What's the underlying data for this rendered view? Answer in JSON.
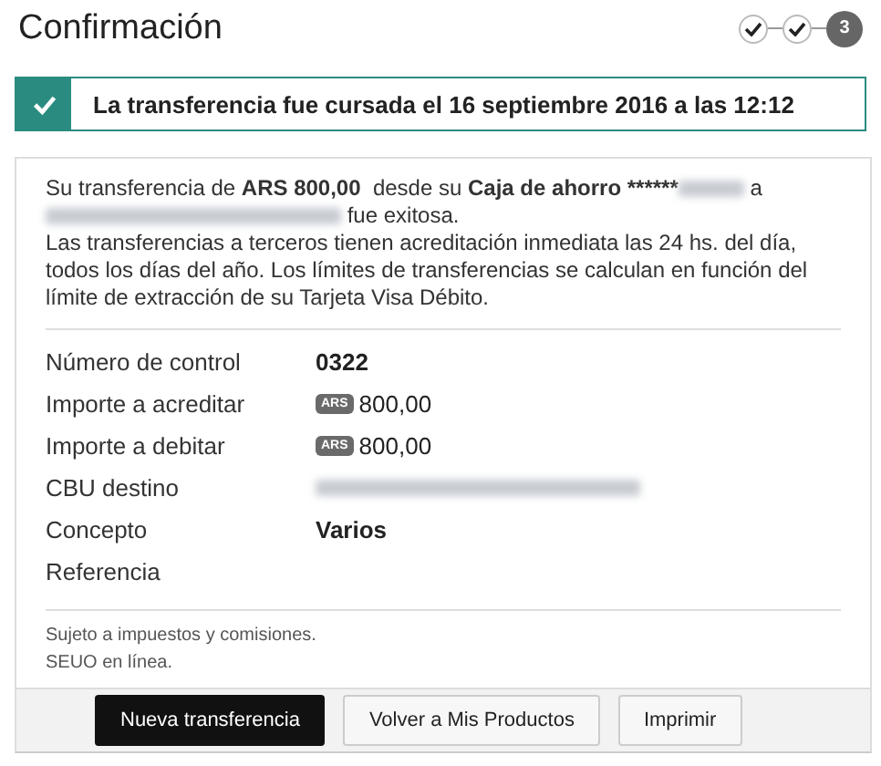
{
  "title": "Confirmación",
  "steps": [
    {
      "done": true
    },
    {
      "done": true
    },
    {
      "done": false,
      "label": "3"
    }
  ],
  "banner": {
    "text": "La transferencia fue cursada el 16 septiembre 2016 a las 12:12"
  },
  "summary": [
    {
      "text": "Su transferencia de "
    },
    {
      "text": "ARS 800,00",
      "bold": true
    },
    {
      "text": "  desde su "
    },
    {
      "text": "Caja de ahorro ******",
      "bold": true
    },
    {
      "kind": "blurred"
    },
    {
      "text": " a "
    },
    {
      "kind": "blurred",
      "wide": true
    },
    {
      "text": " fue exitosa."
    }
  ],
  "note": "Las transferencias a terceros tienen acreditación inmediata las 24 hs. del día, todos los días del año. Los límites de transferencias se calculan en función del límite de extracción de su Tarjeta Visa Débito.",
  "details": [
    {
      "kind": "bold",
      "label": "Número de control",
      "value": "0322"
    },
    {
      "kind": "amount",
      "label": "Importe a acreditar",
      "currency": "ARS",
      "value": "800,00"
    },
    {
      "kind": "amount",
      "label": "Importe a debitar",
      "currency": "ARS",
      "value": "800,00"
    },
    {
      "kind": "blurred",
      "label": "CBU destino"
    },
    {
      "kind": "bold",
      "label": "Concepto",
      "value": "Varios"
    },
    {
      "kind": "empty",
      "label": "Referencia"
    }
  ],
  "footnotes": [
    "Sujeto a impuestos y comisiones.",
    "SEUO en línea."
  ],
  "buttons": [
    {
      "label": "Nueva transferencia",
      "primary": true
    },
    {
      "label": "Volver a Mis Productos",
      "primary": false
    },
    {
      "label": "Imprimir",
      "primary": false
    }
  ]
}
